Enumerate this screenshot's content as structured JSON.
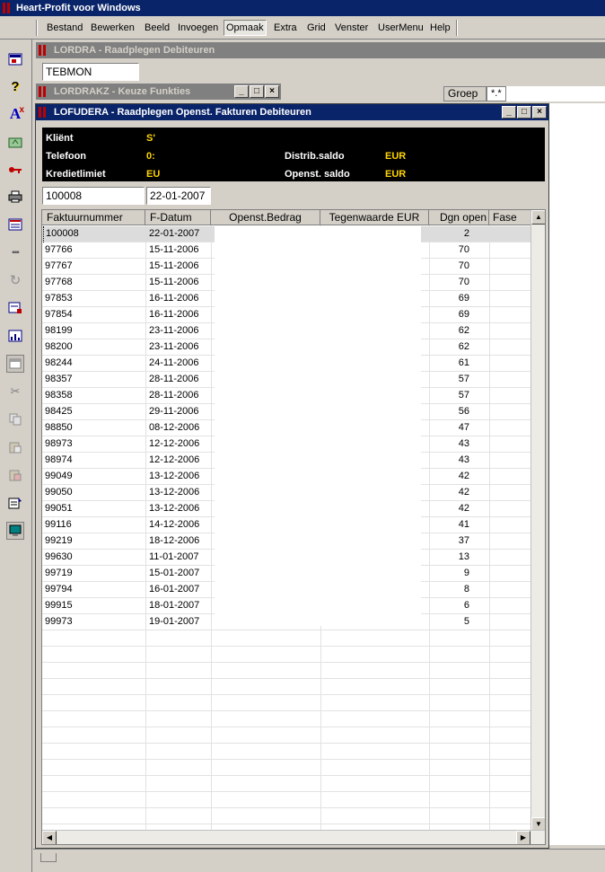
{
  "app": {
    "title": "Heart-Profit voor Windows"
  },
  "menu": [
    "Bestand",
    "Bewerken",
    "Beeld",
    "Invoegen",
    "Opmaak",
    "Extra",
    "Grid",
    "Venster",
    "UserMenu",
    "Help"
  ],
  "menu_active": "Opmaak",
  "toolbar_icons": [
    "report-icon",
    "help-icon",
    "font-icon",
    "export-icon",
    "key-icon",
    "print-icon",
    "list-icon",
    "dots-icon",
    "refresh-icon",
    "edit-icon",
    "chart-icon",
    "window-icon",
    "cut-icon",
    "copy-icon",
    "paste-icon",
    "paste-special-icon",
    "properties-icon",
    "monitor-icon"
  ],
  "win_lordra": {
    "title": "LORDRA - Raadplegen Debiteuren",
    "field_value": "TEBMON",
    "col_groep": "Groep",
    "col_filter": "*.*"
  },
  "win_lordrakz": {
    "title": "LORDRAKZ - Keuze Funkties"
  },
  "win_lofudera": {
    "title": "LOFUDERA - Raadplegen Openst. Fakturen Debiteuren",
    "info": {
      "klient_label": "Kliënt",
      "klient_value": "S'",
      "telefoon_label": "Telefoon",
      "telefoon_value": "0:",
      "kredietlimiet_label": "Kredietlimiet",
      "kredietlimiet_value": "EU",
      "distrib_label": "Distrib.saldo",
      "distrib_value": "EUR",
      "openst_label": "Openst. saldo",
      "openst_value": "EUR"
    },
    "filter_nummer": "100008",
    "filter_datum": "22-01-2007",
    "columns": [
      "Faktuurnummer",
      "F-Datum",
      "Openst.Bedrag",
      "Tegenwaarde EUR",
      "Dgn open",
      "Fase"
    ],
    "rows": [
      [
        "100008",
        "22-01-2007",
        "2"
      ],
      [
        "97766",
        "15-11-2006",
        "70"
      ],
      [
        "97767",
        "15-11-2006",
        "70"
      ],
      [
        "97768",
        "15-11-2006",
        "70"
      ],
      [
        "97853",
        "16-11-2006",
        "69"
      ],
      [
        "97854",
        "16-11-2006",
        "69"
      ],
      [
        "98199",
        "23-11-2006",
        "62"
      ],
      [
        "98200",
        "23-11-2006",
        "62"
      ],
      [
        "98244",
        "24-11-2006",
        "61"
      ],
      [
        "98357",
        "28-11-2006",
        "57"
      ],
      [
        "98358",
        "28-11-2006",
        "57"
      ],
      [
        "98425",
        "29-11-2006",
        "56"
      ],
      [
        "98850",
        "08-12-2006",
        "47"
      ],
      [
        "98973",
        "12-12-2006",
        "43"
      ],
      [
        "98974",
        "12-12-2006",
        "43"
      ],
      [
        "99049",
        "13-12-2006",
        "42"
      ],
      [
        "99050",
        "13-12-2006",
        "42"
      ],
      [
        "99051",
        "13-12-2006",
        "42"
      ],
      [
        "99116",
        "14-12-2006",
        "41"
      ],
      [
        "99219",
        "18-12-2006",
        "37"
      ],
      [
        "99630",
        "11-01-2007",
        "13"
      ],
      [
        "99719",
        "15-01-2007",
        "9"
      ],
      [
        "99794",
        "16-01-2007",
        "8"
      ],
      [
        "99915",
        "18-01-2007",
        "6"
      ],
      [
        "99973",
        "19-01-2007",
        "5"
      ]
    ]
  }
}
